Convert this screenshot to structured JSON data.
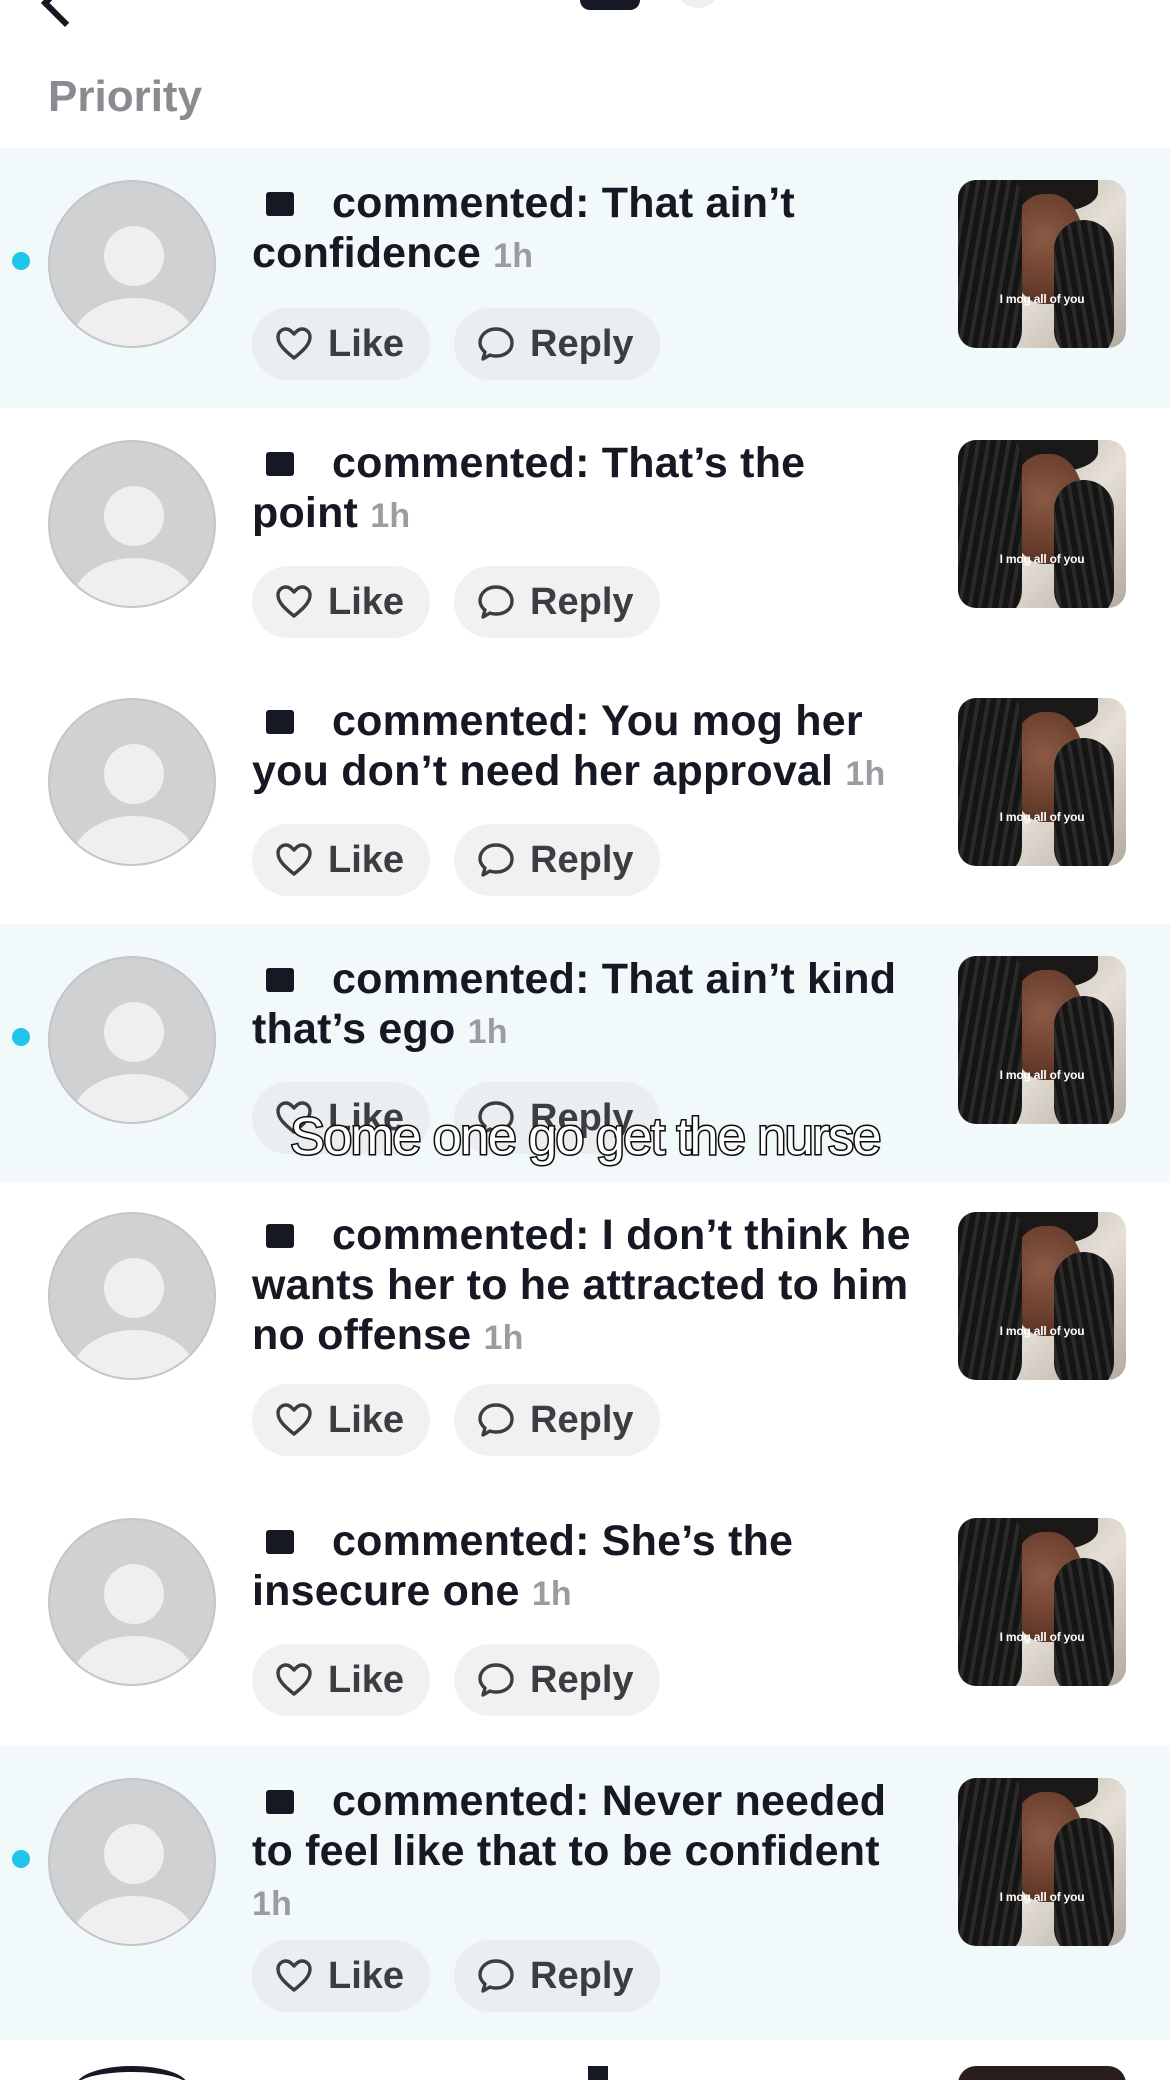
{
  "section": {
    "title": "Priority"
  },
  "actions": {
    "like_label": "Like",
    "reply_label": "Reply"
  },
  "notifications": [
    {
      "text": "commented: That ain’t confidence",
      "time": "1h",
      "unread": true,
      "thumb_caption": "I mog all of you"
    },
    {
      "text": "commented: That’s the point",
      "time": "1h",
      "unread": false,
      "thumb_caption": "I mog all of you"
    },
    {
      "text": "commented: You mog her you don’t need her approval",
      "time": "1h",
      "unread": false,
      "thumb_caption": "I mog all of you"
    },
    {
      "text": "commented: That ain’t kind that’s ego",
      "time": "1h",
      "unread": true,
      "thumb_caption": "I mog all of you"
    },
    {
      "text": "commented: I don’t think he wants her to he attracted to him no offense",
      "time": "1h",
      "unread": false,
      "thumb_caption": "I mog all of you"
    },
    {
      "text": "commented: She’s the insecure one",
      "time": "1h",
      "unread": false,
      "thumb_caption": "I mog all of you"
    },
    {
      "text": "commented: Never needed to feel like that to be confident",
      "time": "1h",
      "unread": true,
      "thumb_caption": "I mog all of you"
    }
  ],
  "overlay": {
    "caption": "Some one go get the nurse"
  },
  "colors": {
    "unread_bg": "#f1f9fb",
    "unread_dot": "#20c4e8",
    "text": "#161823",
    "muted": "#9a9ca2"
  }
}
